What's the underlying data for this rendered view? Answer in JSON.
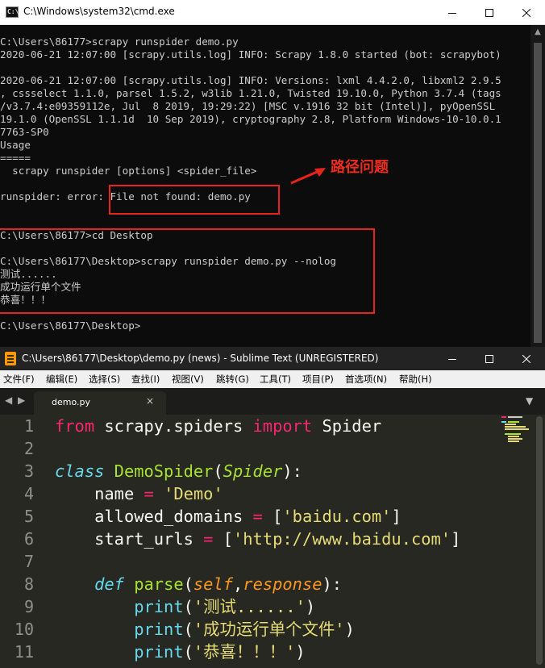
{
  "cmd": {
    "title": "C:\\Windows\\system32\\cmd.exe",
    "icon_label": "C:\\",
    "icon": "console-icon",
    "lines": [
      "C:\\Users\\86177>scrapy runspider demo.py",
      "2020-06-21 12:07:00 [scrapy.utils.log] INFO: Scrapy 1.8.0 started (bot: scrapybot)",
      "",
      "2020-06-21 12:07:00 [scrapy.utils.log] INFO: Versions: lxml 4.4.2.0, libxml2 2.9.5",
      ", cssselect 1.1.0, parsel 1.5.2, w3lib 1.21.0, Twisted 19.10.0, Python 3.7.4 (tags",
      "/v3.7.4:e09359112e, Jul  8 2019, 19:29:22) [MSC v.1916 32 bit (Intel)], pyOpenSSL",
      "19.1.0 (OpenSSL 1.1.1d  10 Sep 2019), cryptography 2.8, Platform Windows-10-10.0.1",
      "7763-SP0",
      "Usage",
      "=====",
      "  scrapy runspider [options] <spider_file>",
      "",
      "runspider: error: File not found: demo.py",
      "",
      "",
      "C:\\Users\\86177>cd Desktop",
      "",
      "C:\\Users\\86177\\Desktop>scrapy runspider demo.py --nolog",
      "测试......",
      "成功运行单个文件",
      "恭喜！！！",
      "",
      "C:\\Users\\86177\\Desktop>"
    ],
    "annotation": "路径问题"
  },
  "sublime": {
    "title": "C:\\Users\\86177\\Desktop\\demo.py (news) - Sublime Text (UNREGISTERED)",
    "menu": [
      "文件(F)",
      "编辑(E)",
      "选择(S)",
      "查找(I)",
      "视图(V)",
      "跳转(G)",
      "工具(T)",
      "项目(P)",
      "首选项(N)",
      "帮助(H)"
    ],
    "tab": {
      "name": "demo.py",
      "close": "×"
    },
    "line_numbers": [
      "1",
      "2",
      "3",
      "4",
      "5",
      "6",
      "7",
      "8",
      "9",
      "10",
      "11"
    ],
    "code": {
      "l1": {
        "kw_from": "from",
        "mod": " scrapy.spiders ",
        "kw_import": "import",
        "name": " Spider"
      },
      "l3": {
        "kw_class": "class",
        "sp": " ",
        "cls_name": "DemoSpider",
        "lp": "(",
        "base": "Spider",
        "rp": "):"
      },
      "l4": {
        "indent": "    ",
        "var": "name",
        "eq": " = ",
        "val": "'Demo'"
      },
      "l5": {
        "indent": "    ",
        "var": "allowed_domains",
        "eq": " = ",
        "lb": "[",
        "val": "'baidu.com'",
        "rb": "]"
      },
      "l6": {
        "indent": "    ",
        "var": "start_urls",
        "eq": " = ",
        "lb": "[",
        "val": "'http://www.baidu.com'",
        "rb": "]"
      },
      "l8": {
        "indent": "    ",
        "kw_def": "def",
        "sp": " ",
        "fn_name": "parse",
        "lp": "(",
        "p1": "self",
        "comma": ",",
        "p2": "response",
        "rp": "):"
      },
      "l9": {
        "indent": "        ",
        "fn": "print",
        "lp": "(",
        "val": "'测试......'",
        "rp": ")"
      },
      "l10": {
        "indent": "        ",
        "fn": "print",
        "lp": "(",
        "val": "'成功运行单个文件'",
        "rp": ")"
      },
      "l11": {
        "indent": "        ",
        "fn": "print",
        "lp": "(",
        "val": "'恭喜！！！'",
        "rp": ")"
      }
    }
  },
  "colors": {
    "annotation_red": "#e8231c",
    "keyword": "#f92672",
    "storage_type": "#66d9ef",
    "entity": "#a6e22e",
    "string": "#e6db74",
    "parameter": "#fd971f"
  }
}
